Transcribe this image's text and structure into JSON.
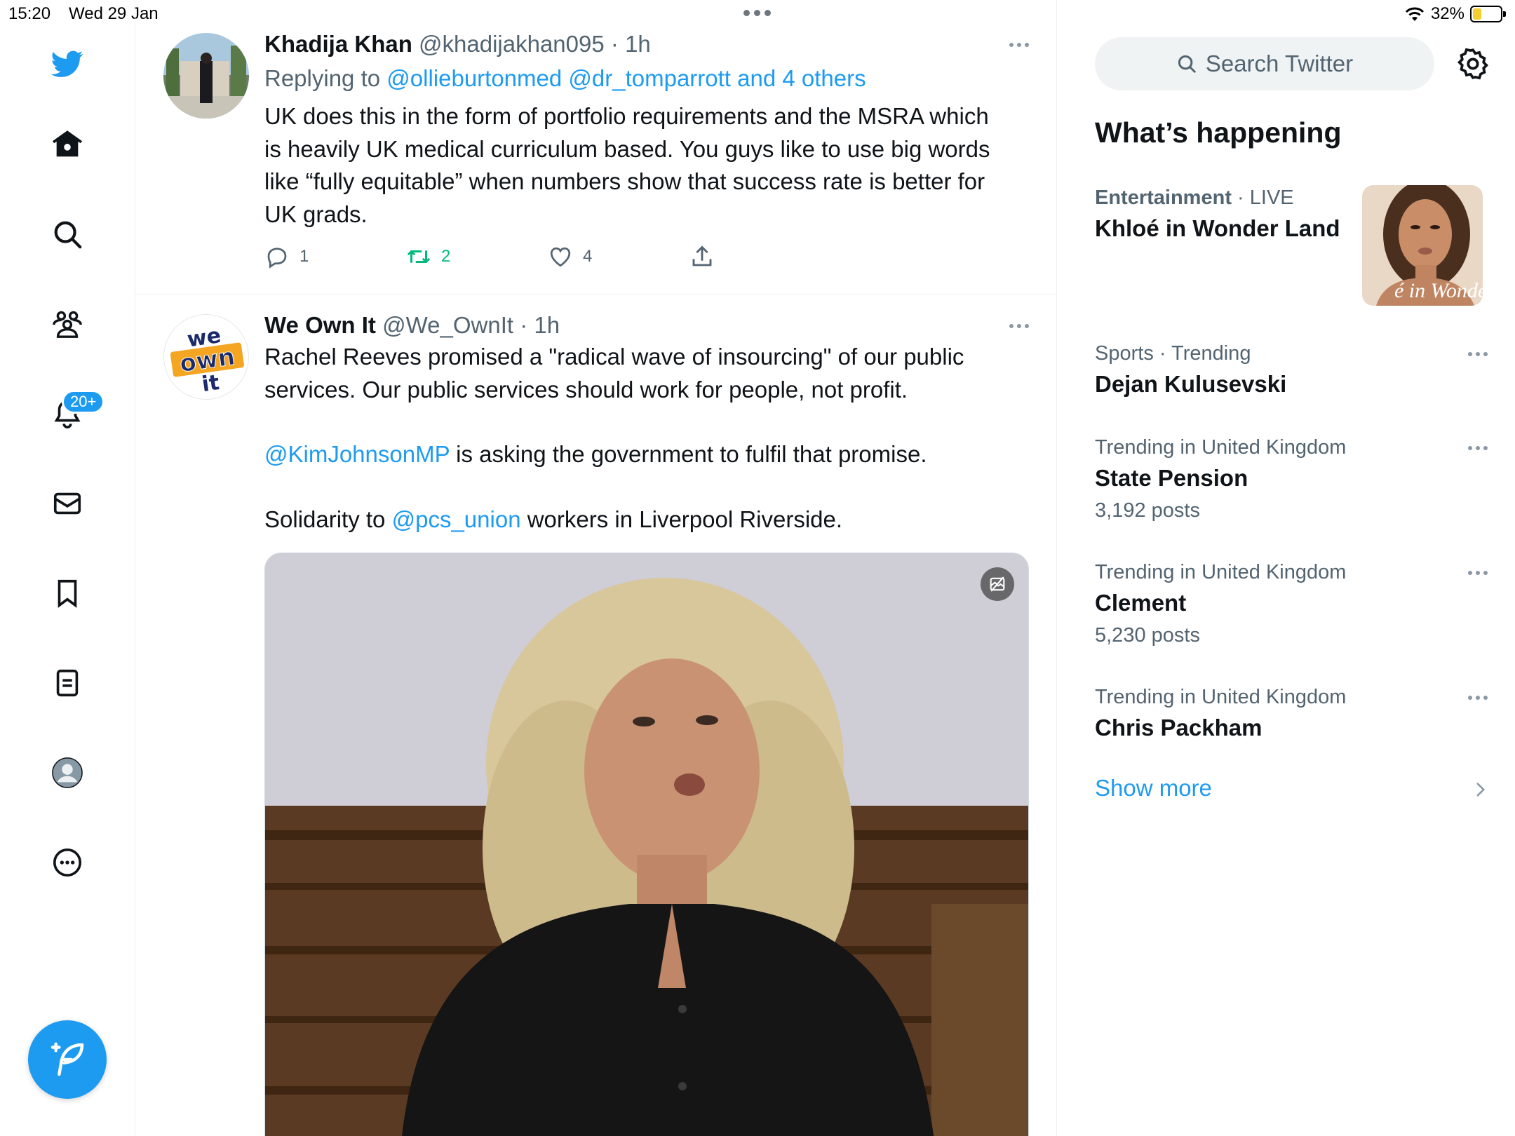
{
  "status_bar": {
    "time": "15:20",
    "date": "Wed 29 Jan",
    "battery": "32%",
    "battery_level": 0.32
  },
  "nav": {
    "items": [
      "twitter-logo",
      "home",
      "explore",
      "communities",
      "notifications",
      "messages",
      "bookmarks",
      "lists",
      "profile",
      "more"
    ],
    "notifications_badge": "20+"
  },
  "tweets": [
    {
      "name": "Khadija Khan",
      "handle": "@khadijakhan095",
      "time": "· 1h",
      "replying_prefix": "Replying to ",
      "replying_users": "@ollieburtonmed @dr_tomparrott",
      "replying_suffix": " and 4 others",
      "text": "UK does this in the form of portfolio requirements and the MSRA which is heavily UK medical curriculum based. You guys like to use big words like “fully equitable” when numbers show that success rate is better for UK grads.",
      "replies": "1",
      "retweets": "2",
      "likes": "4"
    },
    {
      "name": "We Own It",
      "handle": "@We_OwnIt",
      "time": "· 1h",
      "avatar_text": [
        "we",
        "own",
        "it"
      ],
      "para1": "Rachel Reeves promised a \"radical wave of insourcing\" of our public services. Our public services should work for people, not profit.",
      "para2_mention": "@KimJohnsonMP",
      "para2_rest": " is asking the government to fulfil that promise.",
      "para3_prefix": "Solidarity to ",
      "para3_mention": "@pcs_union",
      "para3_rest": " workers in Liverpool Riverside."
    }
  ],
  "sidebar": {
    "search_placeholder": "Search Twitter",
    "title": "What’s happening",
    "trends": [
      {
        "category": "Entertainment",
        "status": " · LIVE",
        "title": "Khloé in Wonder Land",
        "image_caption": "é in Wonder L"
      },
      {
        "category": "Sports · Trending",
        "title": "Dejan Kulusevski"
      },
      {
        "category": "Trending in United Kingdom",
        "title": "State Pension",
        "count": "3,192 posts"
      },
      {
        "category": "Trending in United Kingdom",
        "title": "Clement",
        "count": "5,230 posts"
      },
      {
        "category": "Trending in United Kingdom",
        "title": "Chris Packham"
      }
    ],
    "show_more": "Show more"
  },
  "colors": {
    "accent": "#1d9bf0",
    "retweet": "#00ba7c",
    "secondary_text": "#536471"
  },
  "icons": [
    "twitter-bird-icon",
    "home-icon",
    "search-icon",
    "communities-icon",
    "bell-icon",
    "envelope-icon",
    "bookmark-icon",
    "list-icon",
    "avatar-icon",
    "more-circle-icon",
    "compose-icon",
    "reply-icon",
    "retweet-icon",
    "heart-icon",
    "share-icon",
    "gear-icon",
    "chevron-right-icon"
  ]
}
